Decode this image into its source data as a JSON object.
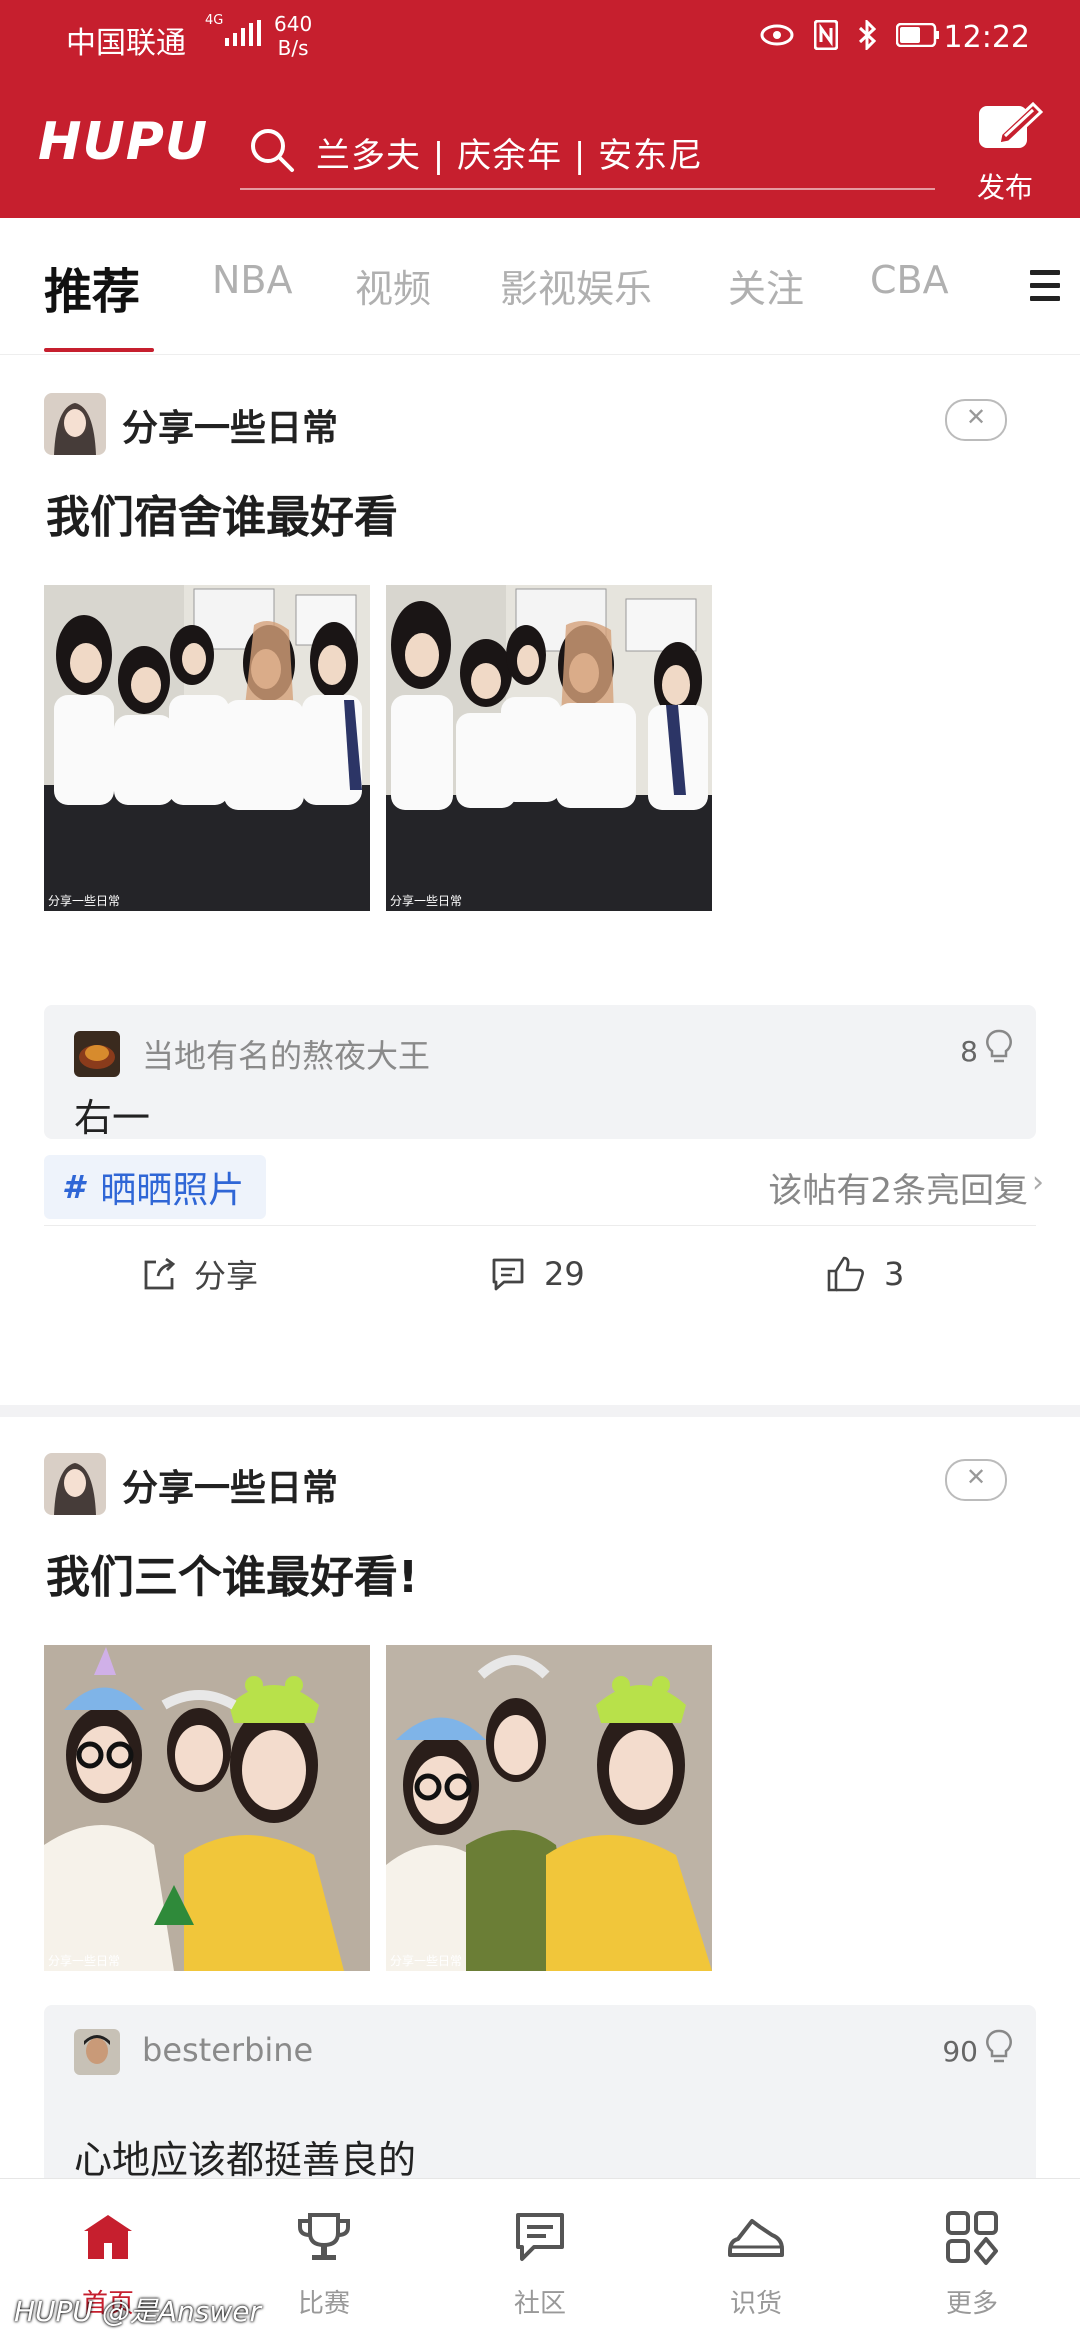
{
  "status_bar": {
    "carrier": "中国联通",
    "network": "4G",
    "speed_value": "640",
    "speed_unit": "B/s",
    "time": "12:22",
    "icons": [
      "eye-icon",
      "nfc-icon",
      "bluetooth-icon",
      "battery-icon"
    ]
  },
  "header": {
    "logo": "HUPU",
    "search_placeholder": "兰多夫 | 庆余年 | 安东尼",
    "publish_label": "发布",
    "brand_color": "#c61f2e"
  },
  "tabs": [
    {
      "label": "推荐",
      "active": true
    },
    {
      "label": "NBA",
      "active": false
    },
    {
      "label": "视频",
      "active": false
    },
    {
      "label": "影视娱乐",
      "active": false
    },
    {
      "label": "关注",
      "active": false
    },
    {
      "label": "CBA",
      "active": false
    }
  ],
  "posts": [
    {
      "board": "分享一些日常",
      "title": "我们宿舍谁最好看",
      "thumb_watermark": "分享一些日常",
      "reply": {
        "user": "当地有名的熬夜大王",
        "likes": "8",
        "text": "右一"
      },
      "tag": "晒晒照片",
      "bright_replies": "该帖有2条亮回复",
      "share_label": "分享",
      "comments": "29",
      "likes": "3"
    },
    {
      "board": "分享一些日常",
      "title": "我们三个谁最好看!",
      "thumb_watermark": "分享一些日常",
      "reply": {
        "user": "besterbine",
        "likes": "90",
        "text": "心地应该都挺善良的"
      }
    }
  ],
  "bottom_nav": [
    {
      "label": "首页",
      "icon": "home-icon",
      "active": true
    },
    {
      "label": "比赛",
      "icon": "trophy-icon",
      "active": false
    },
    {
      "label": "社区",
      "icon": "community-icon",
      "active": false
    },
    {
      "label": "识货",
      "icon": "sneaker-icon",
      "active": false
    },
    {
      "label": "更多",
      "icon": "more-grid-icon",
      "active": false
    }
  ],
  "watermark": "HUPU @是Answer"
}
